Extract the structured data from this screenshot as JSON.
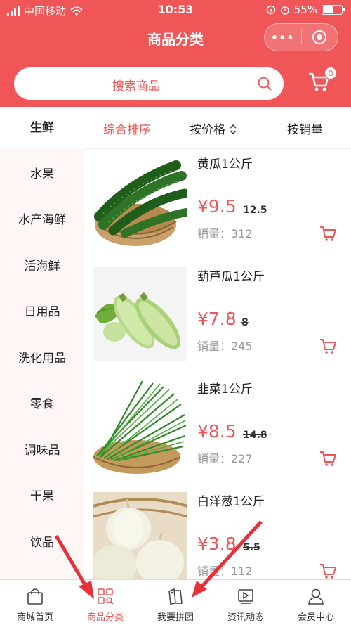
{
  "status": {
    "carrier": "中国移动",
    "time": "10:53",
    "battery": "55%",
    "battery_level": 0.55
  },
  "nav": {
    "title": "商品分类",
    "more_label": "•••"
  },
  "search": {
    "placeholder": "搜索商品",
    "cart_count": "0"
  },
  "sidebar": {
    "items": [
      {
        "label": "生鲜",
        "active": true
      },
      {
        "label": "水果"
      },
      {
        "label": "水产海鲜"
      },
      {
        "label": "活海鲜"
      },
      {
        "label": "日用品"
      },
      {
        "label": "洗化用品"
      },
      {
        "label": "零食"
      },
      {
        "label": "调味品"
      },
      {
        "label": "干果"
      },
      {
        "label": "饮品"
      }
    ]
  },
  "sort": {
    "default": "综合排序",
    "price": "按价格",
    "price_icon": "⌃⌄",
    "sales": "按销量"
  },
  "products": [
    {
      "name": "黄瓜1公斤",
      "price": "¥9.5",
      "original_price": "12.5",
      "sales": "销量：312"
    },
    {
      "name": "葫芦瓜1公斤",
      "price": "¥7.8",
      "original_price": "8",
      "sales": "销量：245"
    },
    {
      "name": "韭菜1公斤",
      "price": "¥8.5",
      "original_price": "14.8",
      "sales": "销量：227"
    },
    {
      "name": "白洋葱1公斤",
      "price": "¥3.8",
      "original_price": "5.5",
      "sales": "销量：112"
    }
  ],
  "tabs": [
    {
      "label": "商城首页",
      "icon": "shopping-bag-icon"
    },
    {
      "label": "商品分类",
      "icon": "category-search-icon",
      "active": true
    },
    {
      "label": "我要拼团",
      "icon": "tag-icon"
    },
    {
      "label": "资讯动态",
      "icon": "play-video-icon"
    },
    {
      "label": "会员中心",
      "icon": "user-icon"
    }
  ],
  "colors": {
    "accent": "#f05558",
    "sidebar_bg": "#fff6f6",
    "arrow": "#e8303a"
  }
}
